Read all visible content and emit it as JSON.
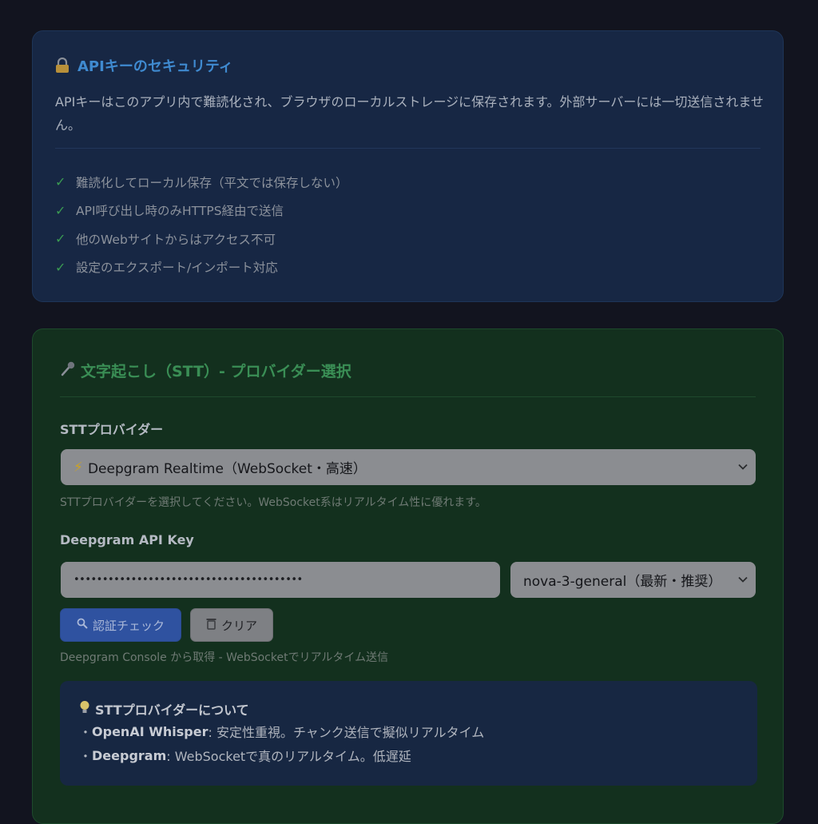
{
  "security": {
    "title": "APIキーのセキュリティ",
    "description": "APIキーはこのアプリ内で難読化され、ブラウザのローカルストレージに保存されます。外部サーバーには一切送信されません。",
    "items": [
      "難読化してローカル保存（平文では保存しない）",
      "API呼び出し時のみHTTPS経由で送信",
      "他のWebサイトからはアクセス不可",
      "設定のエクスポート/インポート対応"
    ]
  },
  "stt": {
    "title": "文字起こし（STT）- プロバイダー選択",
    "provider_label": "STTプロバイダー",
    "provider_selected": "Deepgram Realtime（WebSocket・高速）",
    "provider_hint": "STTプロバイダーを選択してください。WebSocket系はリアルタイム性に優れます。",
    "api_key_label": "Deepgram API Key",
    "api_key_value": "••••••••••••••••••••••••••••••••••••••••",
    "model_selected": "nova-3-general（最新・推奨）",
    "check_button": "認証チェック",
    "clear_button": "クリア",
    "api_key_hint": "Deepgram Console から取得 - WebSocketでリアルタイム送信",
    "info": {
      "title": "STTプロバイダーについて",
      "lines": [
        {
          "bullet": "・",
          "name": "OpenAI Whisper",
          "text": ": 安定性重視。チャンク送信で擬似リアルタイム"
        },
        {
          "bullet": "・",
          "name": "Deepgram",
          "text": ": WebSocketで真のリアルタイム。低遅延"
        }
      ]
    }
  }
}
